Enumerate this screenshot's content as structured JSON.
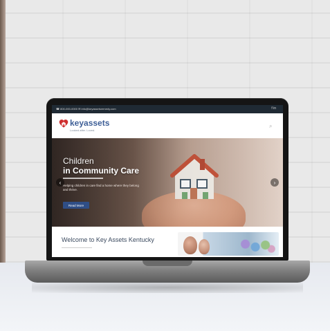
{
  "site": {
    "topbar": {
      "contact_text": "☎ 800-000-0000   ✉ info@keyassetsremedy.com",
      "social_text": "f  in"
    },
    "brand": {
      "logo_text": "keyassets",
      "tagline": "Looked after. Loved."
    },
    "hero": {
      "title_line1": "Children",
      "title_line2": "in Community Care",
      "blurb": "Helping children in care find a home where they belong and thrive.",
      "button_label": "Read More"
    },
    "welcome": {
      "title": "Welcome to Key Assets Kentucky"
    }
  },
  "colors": {
    "primary": "#2f4e86",
    "logo": "#3e5f97",
    "topbar": "#1f2a34"
  },
  "icons": {
    "search": "search-icon",
    "prev": "chevron-left-icon",
    "next": "chevron-right-icon"
  }
}
